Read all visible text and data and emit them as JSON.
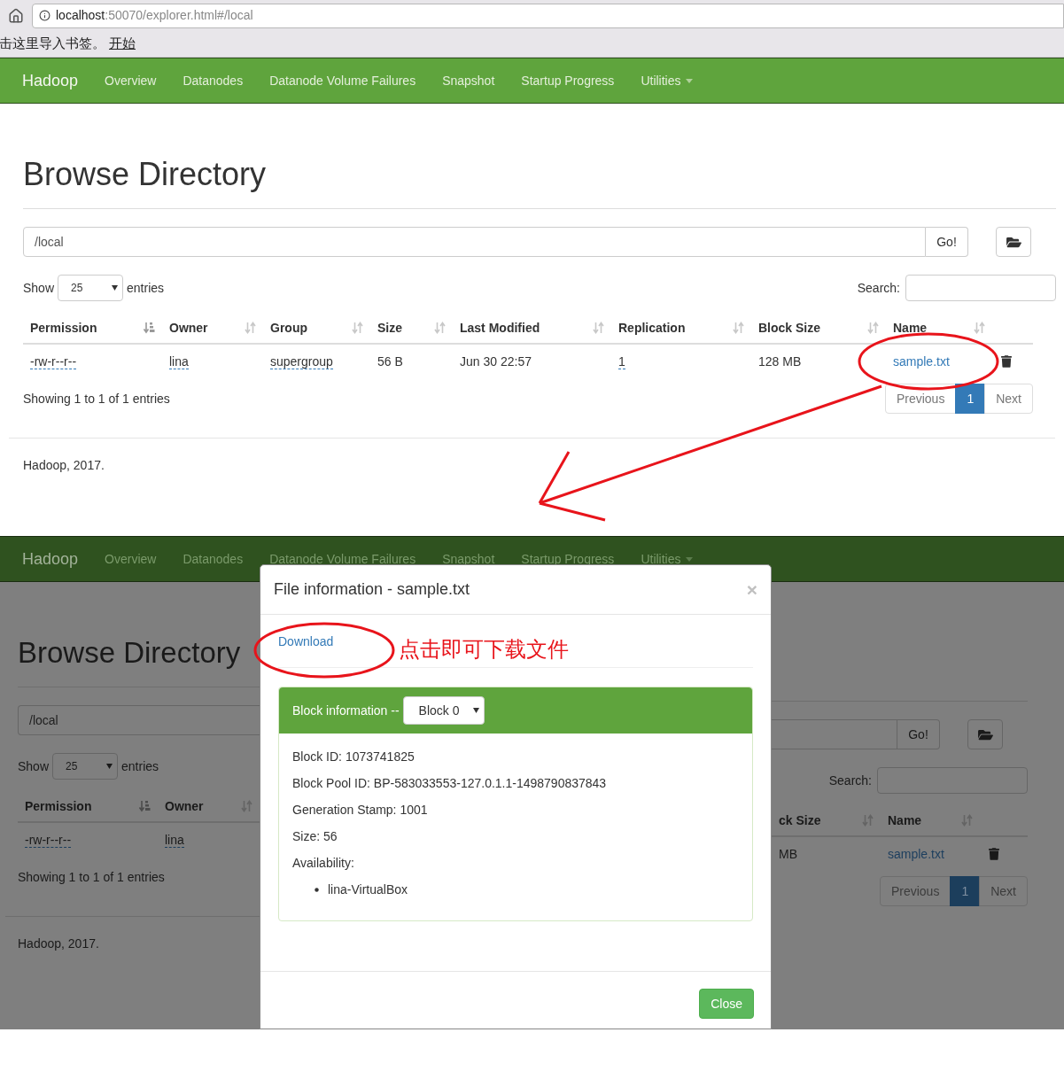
{
  "browser": {
    "url_host": "localhost",
    "url_rest": ":50070/explorer.html#/local",
    "bookmark_hint": "击这里导入书签。",
    "bookmark_link": "开始"
  },
  "top_page": {
    "navbar": {
      "brand": "Hadoop",
      "items": [
        {
          "label": "Overview",
          "kind": "link"
        },
        {
          "label": "Datanodes",
          "kind": "link"
        },
        {
          "label": "Datanode Volume Failures",
          "kind": "link"
        },
        {
          "label": "Snapshot",
          "kind": "link"
        },
        {
          "label": "Startup Progress",
          "kind": "link"
        },
        {
          "label": "Utilities",
          "kind": "dropdown"
        }
      ]
    },
    "title": "Browse Directory",
    "path": "/local",
    "go_button": "Go!",
    "show_label": "Show",
    "page_size": "25",
    "entries_label": "entries",
    "search_label": "Search:",
    "columns": [
      {
        "label": "Permission",
        "sorted": true
      },
      {
        "label": "Owner",
        "sorted": false
      },
      {
        "label": "Group",
        "sorted": false
      },
      {
        "label": "Size",
        "sorted": false
      },
      {
        "label": "Last Modified",
        "sorted": false
      },
      {
        "label": "Replication",
        "sorted": false
      },
      {
        "label": "Block Size",
        "sorted": false
      },
      {
        "label": "Name",
        "sorted": false
      }
    ],
    "rows": [
      {
        "cells": [
          {
            "text": "-rw-r--r--",
            "kind": "abbr"
          },
          {
            "text": "lina",
            "kind": "abbr"
          },
          {
            "text": "supergroup",
            "kind": "abbr"
          },
          {
            "text": "56 B",
            "kind": "text"
          },
          {
            "text": "Jun 30 22:57",
            "kind": "text"
          },
          {
            "text": "1",
            "kind": "abbr"
          },
          {
            "text": "128 MB",
            "kind": "text"
          },
          {
            "text": "sample.txt",
            "kind": "link"
          }
        ]
      }
    ],
    "info": "Showing 1 to 1 of 1 entries",
    "pagination": [
      {
        "label": "Previous",
        "selected": false,
        "disabled": true
      },
      {
        "label": "1",
        "selected": true,
        "disabled": false
      },
      {
        "label": "Next",
        "selected": false,
        "disabled": true
      }
    ],
    "footer": "Hadoop, 2017."
  },
  "bottom_page": {
    "navbar": {
      "brand": "Hadoop",
      "items": [
        {
          "label": "Overview",
          "kind": "link"
        },
        {
          "label": "Datanodes",
          "kind": "link"
        },
        {
          "label": "Datanode Volume Failures",
          "kind": "link"
        },
        {
          "label": "Snapshot",
          "kind": "link"
        },
        {
          "label": "Startup Progress",
          "kind": "link"
        },
        {
          "label": "Utilities",
          "kind": "dropdown"
        }
      ]
    },
    "left": {
      "title": "Browse Directory",
      "path": "/local",
      "show_label": "Show",
      "page_size": "25",
      "entries_label": "entries",
      "columns": [
        {
          "label": "Permission",
          "sorted": true
        },
        {
          "label": "Owner",
          "sorted": false
        }
      ],
      "rows": [
        {
          "cells": [
            {
              "text": "-rw-r--r--",
              "kind": "abbr"
            },
            {
              "text": "lina",
              "kind": "abbr"
            }
          ]
        }
      ],
      "info": "Showing 1 to 1 of 1 entries",
      "footer": "Hadoop, 2017."
    },
    "right": {
      "go_button": "Go!",
      "search_label": "Search:",
      "columns": [
        {
          "label": "ck Size",
          "sorted": false
        },
        {
          "label": "Name",
          "sorted": false
        }
      ],
      "rows": [
        {
          "cells": [
            {
              "text": "MB",
              "kind": "text"
            },
            {
              "text": "sample.txt",
              "kind": "link"
            }
          ]
        }
      ],
      "pagination": [
        {
          "label": "Previous",
          "selected": false,
          "disabled": true
        },
        {
          "label": "1",
          "selected": true,
          "disabled": false
        },
        {
          "label": "Next",
          "selected": false,
          "disabled": true
        }
      ]
    }
  },
  "modal": {
    "title": "File information - sample.txt",
    "close_glyph": "×",
    "download_link": "Download",
    "panel_label": "Block information --",
    "block_select": "Block 0",
    "details": [
      "Block ID: 1073741825",
      "Block Pool ID: BP-583033553-127.0.1.1-1498790837843",
      "Generation Stamp: 1001",
      "Size: 56",
      "Availability:"
    ],
    "availability": [
      "lina-VirtualBox"
    ],
    "close_button": "Close"
  },
  "annotations": {
    "note": "点击即可下载文件"
  }
}
